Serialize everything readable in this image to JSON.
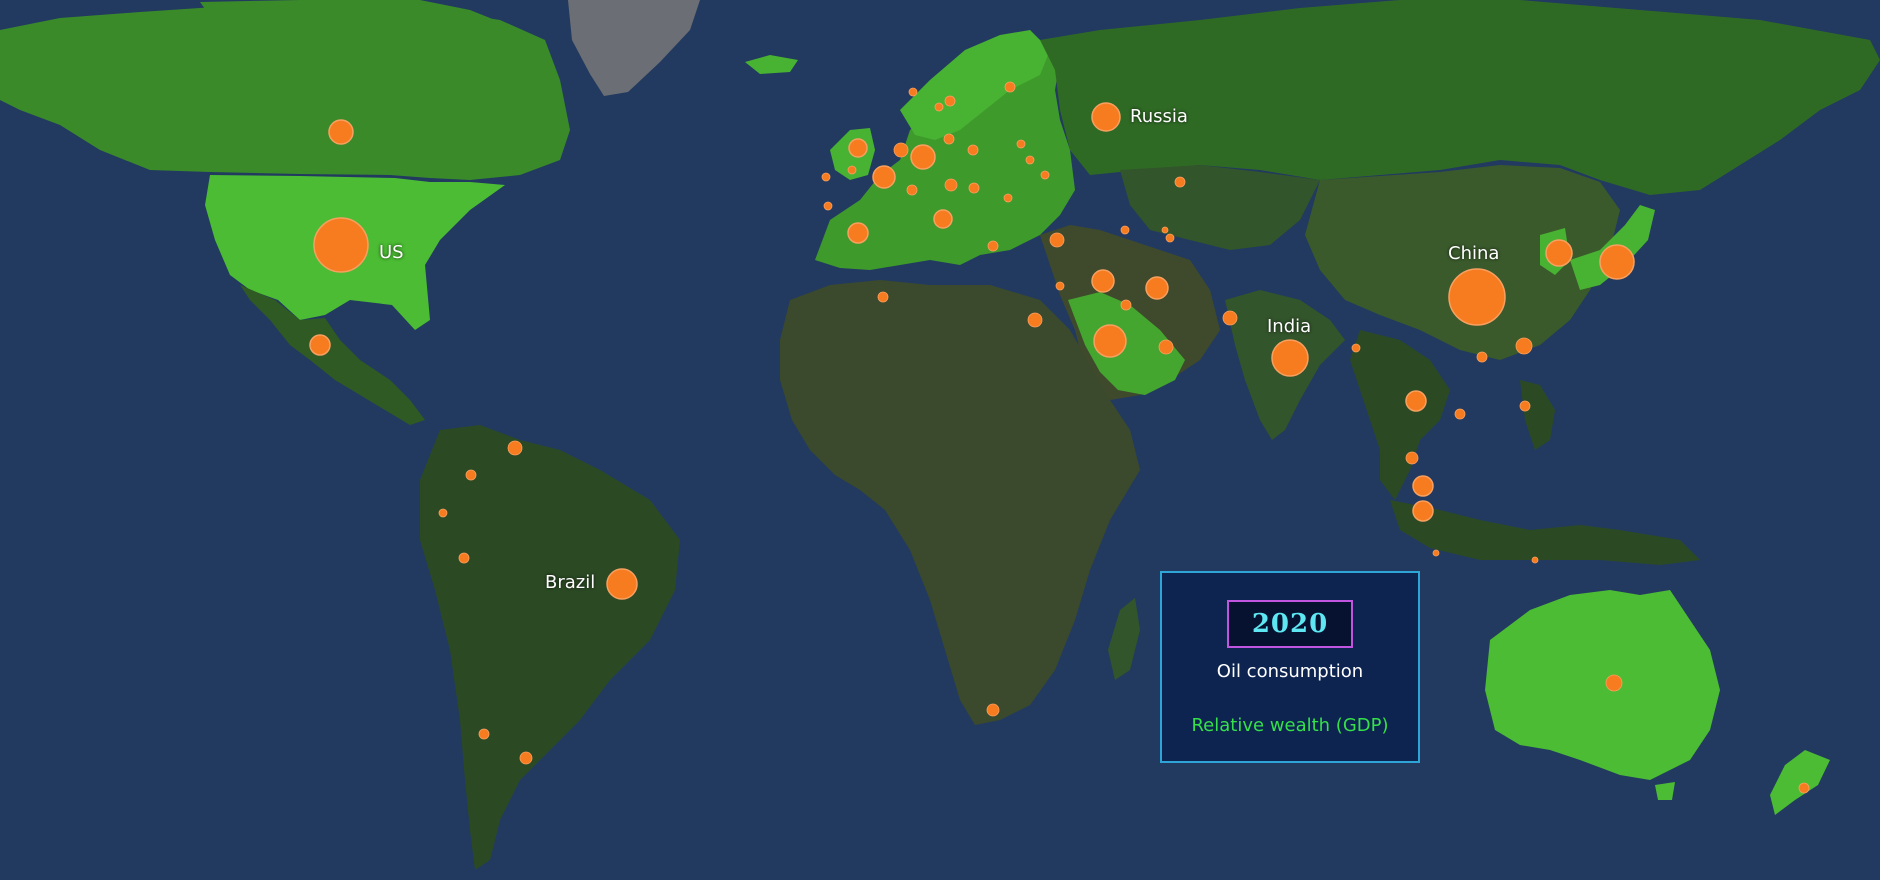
{
  "colors": {
    "ocean": "#223a5f",
    "land_dark": "#2b4a24",
    "land_mid": "#356b26",
    "land_bright": "#3fae2c",
    "land_arid": "#4a4a34",
    "ice": "#6b6f75",
    "bubble": "#f77b1f",
    "legend_bg": "#0d2350",
    "legend_border": "#2fa4d6",
    "year_border": "#c155e0",
    "year_text": "#5ee6f2",
    "gdp_text": "#35e04a"
  },
  "country_labels": [
    "US",
    "Russia",
    "China",
    "India",
    "Brazil"
  ],
  "legend": {
    "year": "2020",
    "oil_label": "Oil consumption",
    "gdp_label": "Relative wealth (GDP)"
  },
  "bubble_count": 66
}
